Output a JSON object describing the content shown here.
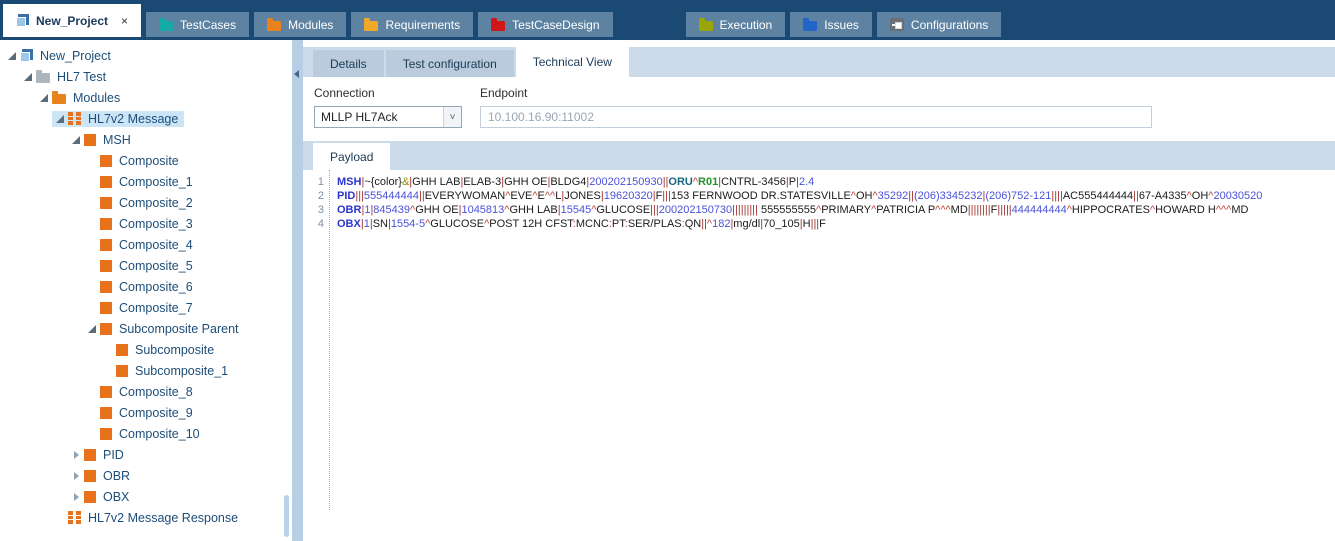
{
  "topbar": {
    "tabs": [
      {
        "label": "New_Project",
        "icon": "project",
        "active": true,
        "closable": true
      },
      {
        "label": "TestCases",
        "icon": "folder",
        "color": "#17a9a4"
      },
      {
        "label": "Modules",
        "icon": "folder",
        "color": "#e8821d"
      },
      {
        "label": "Requirements",
        "icon": "folder",
        "color": "#f0a828"
      },
      {
        "label": "TestCaseDesign",
        "icon": "folder",
        "color": "#d01616"
      },
      {
        "label": "Execution",
        "icon": "folder",
        "color": "#99a506"
      },
      {
        "label": "Issues",
        "icon": "folder",
        "color": "#2165c9"
      },
      {
        "label": "Configurations",
        "icon": "config",
        "color": "#686f75"
      }
    ]
  },
  "tree": {
    "items": [
      {
        "label": "New_Project",
        "level": 0,
        "icon": "project",
        "exp": "open"
      },
      {
        "label": "HL7 Test",
        "level": 1,
        "icon": "folder",
        "color": "#aeb6bd",
        "exp": "open"
      },
      {
        "label": "Modules",
        "level": 2,
        "icon": "folder",
        "color": "#e8821d",
        "exp": "open"
      },
      {
        "label": "HL7v2 Message",
        "level": 3,
        "icon": "hl7",
        "exp": "open",
        "selected": true
      },
      {
        "label": "MSH",
        "level": 4,
        "icon": "square",
        "exp": "open"
      },
      {
        "label": "Composite",
        "level": 5,
        "icon": "square",
        "exp": "none"
      },
      {
        "label": "Composite_1",
        "level": 5,
        "icon": "square",
        "exp": "none"
      },
      {
        "label": "Composite_2",
        "level": 5,
        "icon": "square",
        "exp": "none"
      },
      {
        "label": "Composite_3",
        "level": 5,
        "icon": "square",
        "exp": "none"
      },
      {
        "label": "Composite_4",
        "level": 5,
        "icon": "square",
        "exp": "none"
      },
      {
        "label": "Composite_5",
        "level": 5,
        "icon": "square",
        "exp": "none"
      },
      {
        "label": "Composite_6",
        "level": 5,
        "icon": "square",
        "exp": "none"
      },
      {
        "label": "Composite_7",
        "level": 5,
        "icon": "square",
        "exp": "none"
      },
      {
        "label": "Subcomposite Parent",
        "level": 5,
        "icon": "square",
        "exp": "open"
      },
      {
        "label": "Subcomposite",
        "level": 6,
        "icon": "square",
        "exp": "none"
      },
      {
        "label": "Subcomposite_1",
        "level": 6,
        "icon": "square",
        "exp": "none"
      },
      {
        "label": "Composite_8",
        "level": 5,
        "icon": "square",
        "exp": "none"
      },
      {
        "label": "Composite_9",
        "level": 5,
        "icon": "square",
        "exp": "none"
      },
      {
        "label": "Composite_10",
        "level": 5,
        "icon": "square",
        "exp": "none"
      },
      {
        "label": "PID",
        "level": 4,
        "icon": "square",
        "exp": "closed"
      },
      {
        "label": "OBR",
        "level": 4,
        "icon": "square",
        "exp": "closed"
      },
      {
        "label": "OBX",
        "level": 4,
        "icon": "square",
        "exp": "closed"
      },
      {
        "label": "HL7v2 Message Response",
        "level": 3,
        "icon": "hl7",
        "exp": "none"
      }
    ]
  },
  "main": {
    "tabs": [
      {
        "label": "Details"
      },
      {
        "label": "Test configuration"
      },
      {
        "label": "Technical View",
        "active": true
      }
    ],
    "connection": {
      "label": "Connection",
      "value": "MLLP HL7Ack"
    },
    "endpoint": {
      "label": "Endpoint",
      "value": "10.100.16.90:11002"
    },
    "payload": {
      "tab_label": "Payload",
      "lines": [
        {
          "n": "1",
          "tokens": [
            [
              "seg",
              "MSH"
            ],
            [
              "sep",
              "|"
            ],
            [
              "txt",
              "~{color}"
            ],
            [
              "amp",
              "&"
            ],
            [
              "sep",
              "|"
            ],
            [
              "txt",
              "GHH LAB"
            ],
            [
              "sep",
              "|"
            ],
            [
              "txt",
              "ELAB-3"
            ],
            [
              "sep",
              "|"
            ],
            [
              "txt",
              "GHH OE"
            ],
            [
              "sep",
              "|"
            ],
            [
              "txt",
              "BLDG4"
            ],
            [
              "sep",
              "|"
            ],
            [
              "num",
              "200202150930"
            ],
            [
              "sep",
              "||"
            ],
            [
              "oru",
              "ORU"
            ],
            [
              "car",
              "^"
            ],
            [
              "r01",
              "R01"
            ],
            [
              "sep",
              "|"
            ],
            [
              "txt",
              "CNTRL-3456"
            ],
            [
              "sep",
              "|"
            ],
            [
              "txt",
              "P"
            ],
            [
              "sep",
              "|"
            ],
            [
              "num",
              "2.4"
            ]
          ]
        },
        {
          "n": "2",
          "tokens": [
            [
              "seg",
              "PID"
            ],
            [
              "sep",
              "|||"
            ],
            [
              "num",
              "555444444"
            ],
            [
              "sep",
              "||"
            ],
            [
              "txt",
              "EVERYWOMAN"
            ],
            [
              "car",
              "^"
            ],
            [
              "txt",
              "EVE"
            ],
            [
              "car",
              "^"
            ],
            [
              "txt",
              "E"
            ],
            [
              "car",
              "^^"
            ],
            [
              "txt",
              "L"
            ],
            [
              "sep",
              "|"
            ],
            [
              "txt",
              "JONES"
            ],
            [
              "sep",
              "|"
            ],
            [
              "num",
              "19620320"
            ],
            [
              "sep",
              "|"
            ],
            [
              "txt",
              "F"
            ],
            [
              "sep",
              "|||"
            ],
            [
              "txt",
              "153 FERNWOOD DR.STATESVILLE"
            ],
            [
              "car",
              "^"
            ],
            [
              "txt",
              "OH"
            ],
            [
              "car",
              "^"
            ],
            [
              "num",
              "35292"
            ],
            [
              "sep",
              "||"
            ],
            [
              "num",
              "(206)3345232"
            ],
            [
              "sep",
              "|"
            ],
            [
              "num",
              "(206)752-121"
            ],
            [
              "sep",
              "||||"
            ],
            [
              "txt",
              "AC555444444"
            ],
            [
              "sep",
              "||"
            ],
            [
              "txt",
              "67-A4335"
            ],
            [
              "car",
              "^"
            ],
            [
              "txt",
              "OH"
            ],
            [
              "car",
              "^"
            ],
            [
              "num",
              "20030520"
            ]
          ]
        },
        {
          "n": "3",
          "tokens": [
            [
              "seg",
              "OBR"
            ],
            [
              "sep",
              "|"
            ],
            [
              "num",
              "1"
            ],
            [
              "sep",
              "|"
            ],
            [
              "num",
              "845439"
            ],
            [
              "car",
              "^"
            ],
            [
              "txt",
              "GHH OE"
            ],
            [
              "sep",
              "|"
            ],
            [
              "num",
              "1045813"
            ],
            [
              "car",
              "^"
            ],
            [
              "txt",
              "GHH LAB"
            ],
            [
              "sep",
              "|"
            ],
            [
              "num",
              "15545"
            ],
            [
              "car",
              "^"
            ],
            [
              "txt",
              "GLUCOSE"
            ],
            [
              "sep",
              "|||"
            ],
            [
              "num",
              "200202150730"
            ],
            [
              "sep",
              "|||||||||"
            ],
            [
              "txt",
              " 555555555"
            ],
            [
              "car",
              "^"
            ],
            [
              "txt",
              "PRIMARY"
            ],
            [
              "car",
              "^"
            ],
            [
              "txt",
              "PATRICIA P"
            ],
            [
              "car",
              "^^^"
            ],
            [
              "txt",
              "MD"
            ],
            [
              "sep",
              "||||||||"
            ],
            [
              "txt",
              "F"
            ],
            [
              "sep",
              "|||||"
            ],
            [
              "num",
              "444444444"
            ],
            [
              "car",
              "^"
            ],
            [
              "txt",
              "HIPPOCRATES"
            ],
            [
              "car",
              "^"
            ],
            [
              "txt",
              "HOWARD H"
            ],
            [
              "car",
              "^^^"
            ],
            [
              "txt",
              "MD"
            ]
          ]
        },
        {
          "n": "4",
          "tokens": [
            [
              "seg",
              "OBX"
            ],
            [
              "sep",
              "|"
            ],
            [
              "num",
              "1"
            ],
            [
              "sep",
              "|"
            ],
            [
              "txt",
              "SN"
            ],
            [
              "sep",
              "|"
            ],
            [
              "num",
              "1554-5"
            ],
            [
              "car",
              "^"
            ],
            [
              "txt",
              "GLUCOSE"
            ],
            [
              "car",
              "^"
            ],
            [
              "txt",
              "POST 12H CFST"
            ],
            [
              "col",
              ":"
            ],
            [
              "txt",
              "MCNC"
            ],
            [
              "col",
              ":"
            ],
            [
              "txt",
              "PT"
            ],
            [
              "col",
              ":"
            ],
            [
              "txt",
              "SER/PLAS"
            ],
            [
              "col",
              ":"
            ],
            [
              "txt",
              "QN"
            ],
            [
              "sep",
              "||"
            ],
            [
              "car",
              "^"
            ],
            [
              "num",
              "182"
            ],
            [
              "sep",
              "|"
            ],
            [
              "txt",
              "mg/dl"
            ],
            [
              "sep",
              "|"
            ],
            [
              "txt",
              "70_105"
            ],
            [
              "sep",
              "|"
            ],
            [
              "txt",
              "H"
            ],
            [
              "sep",
              "|||"
            ],
            [
              "txt",
              "F"
            ]
          ]
        }
      ]
    }
  },
  "icons": {
    "select_arrow": "˅",
    "close": "×"
  },
  "colors": {
    "topbar_bg": "#1a4a73",
    "inactive_tab_bg": "#5e82a2",
    "strip_bg": "#ccdbe9",
    "selection_bg": "#cbe5f7",
    "tree_text": "#1d4e79",
    "orange_accent": "#e8711c"
  }
}
